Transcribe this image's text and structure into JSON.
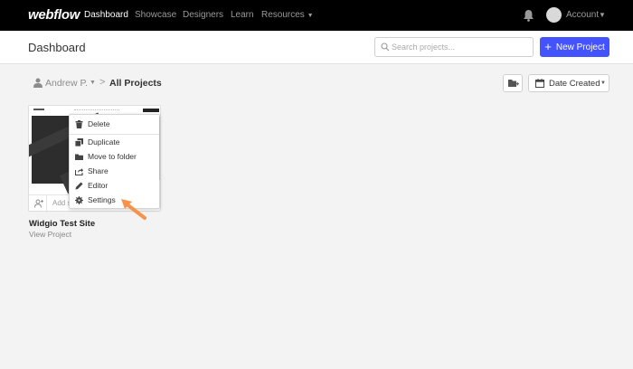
{
  "nav": {
    "logo": "webflow",
    "links": [
      "Dashboard",
      "Showcase",
      "Designers",
      "Learn",
      "Resources"
    ],
    "account": "Account",
    "icons": [
      "bell-icon",
      "avatar",
      "chevron-down-icon"
    ]
  },
  "header": {
    "title": "Dashboard",
    "search_placeholder": "Search projects...",
    "new_project": "New Project"
  },
  "breadcrumb": {
    "user": "Andrew P.",
    "separator": ">",
    "current": "All Projects"
  },
  "toolbar": {
    "sort_label": "Date Created"
  },
  "project": {
    "name": "Widgio Test Site",
    "link": "View Project",
    "add_text": "Add s"
  },
  "context_menu": {
    "items": [
      "Delete",
      "Duplicate",
      "Move to folder",
      "Share",
      "Editor",
      "Settings"
    ]
  },
  "colors": {
    "accent": "#4353ff",
    "nav_bg": "#000000",
    "annotation": "#f7924a"
  }
}
